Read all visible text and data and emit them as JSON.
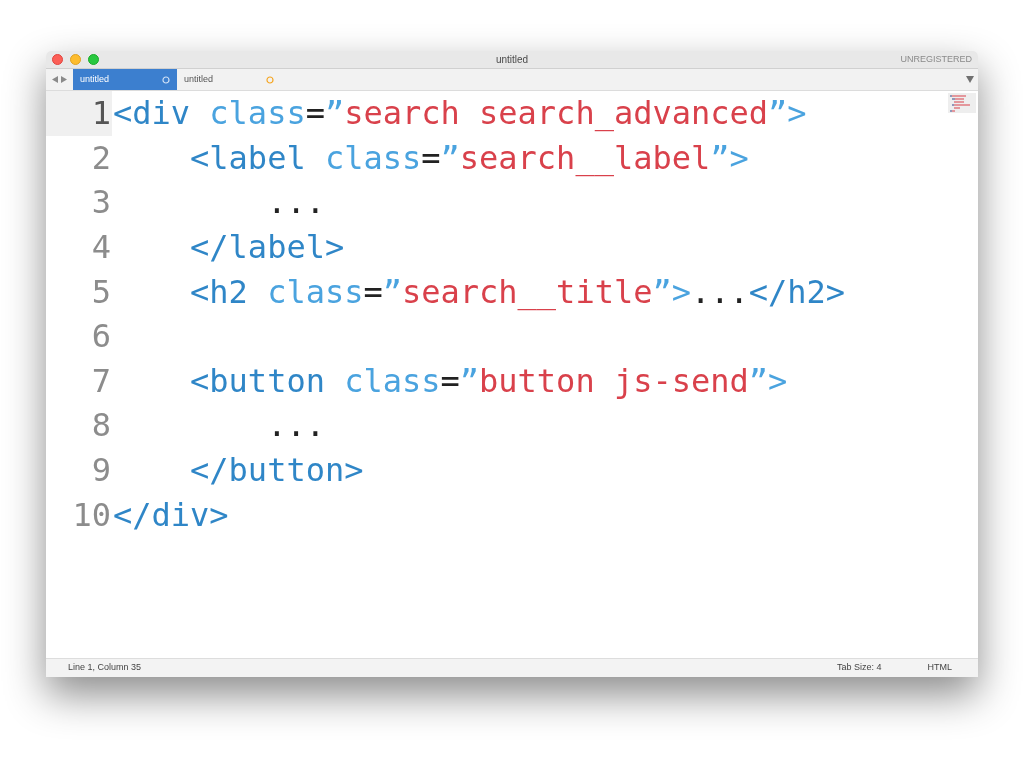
{
  "window": {
    "title": "untitled",
    "badge": "UNREGISTERED"
  },
  "tabs": [
    {
      "label": "untitled",
      "selected": true
    },
    {
      "label": "untitled",
      "selected": false
    }
  ],
  "editor": {
    "lines": [
      {
        "number": "1",
        "current": true,
        "tokens": [
          {
            "kind": "tag",
            "text": "<div"
          },
          {
            "kind": "attr",
            "text": " class"
          },
          {
            "kind": "punct",
            "text": "="
          },
          {
            "kind": "attr",
            "text": "”"
          },
          {
            "kind": "string",
            "text": "search search_advanced"
          },
          {
            "kind": "attr",
            "text": "”>"
          }
        ]
      },
      {
        "number": "2",
        "current": false,
        "tokens": [
          {
            "kind": "tag",
            "text": "    <label"
          },
          {
            "kind": "attr",
            "text": " class"
          },
          {
            "kind": "punct",
            "text": "="
          },
          {
            "kind": "attr",
            "text": "”"
          },
          {
            "kind": "string",
            "text": "search__label"
          },
          {
            "kind": "attr",
            "text": "”>"
          }
        ]
      },
      {
        "number": "3",
        "current": false,
        "tokens": [
          {
            "kind": "punct",
            "text": "        ..."
          }
        ]
      },
      {
        "number": "4",
        "current": false,
        "tokens": [
          {
            "kind": "tag",
            "text": "    </label>"
          }
        ]
      },
      {
        "number": "5",
        "current": false,
        "tokens": [
          {
            "kind": "tag",
            "text": "    <h2"
          },
          {
            "kind": "attr",
            "text": " class"
          },
          {
            "kind": "punct",
            "text": "="
          },
          {
            "kind": "attr",
            "text": "”"
          },
          {
            "kind": "string",
            "text": "search__title"
          },
          {
            "kind": "attr",
            "text": "”>"
          },
          {
            "kind": "punct",
            "text": "..."
          },
          {
            "kind": "tag",
            "text": "</h2>"
          }
        ]
      },
      {
        "number": "6",
        "current": false
      },
      {
        "number": "7",
        "current": false,
        "tokens": [
          {
            "kind": "tag",
            "text": "    <button"
          },
          {
            "kind": "attr",
            "text": " class"
          },
          {
            "kind": "punct",
            "text": "="
          },
          {
            "kind": "attr",
            "text": "”"
          },
          {
            "kind": "string",
            "text": "button js-send"
          },
          {
            "kind": "attr",
            "text": "”>"
          }
        ]
      },
      {
        "number": "8",
        "current": false,
        "tokens": [
          {
            "kind": "punct",
            "text": "        ..."
          }
        ]
      },
      {
        "number": "9",
        "current": false,
        "tokens": [
          {
            "kind": "tag",
            "text": "    </button>"
          }
        ]
      },
      {
        "number": "10",
        "current": false,
        "tokens": [
          {
            "kind": "tag",
            "text": "</div>"
          }
        ]
      }
    ]
  },
  "status_bar": {
    "position": "Line 1, Column 35",
    "tab_size": "Tab Size: 4",
    "syntax": "HTML"
  }
}
